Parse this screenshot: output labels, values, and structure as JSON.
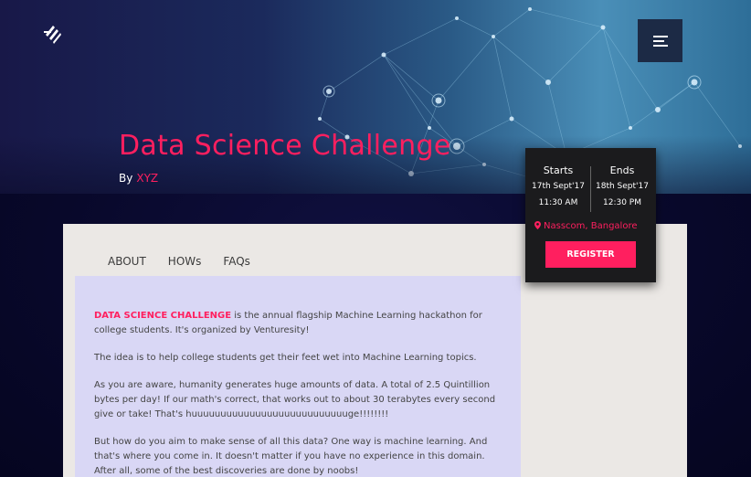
{
  "header": {
    "menu_icon": "hamburger-menu-icon",
    "logo_icon": "brand-logo-icon",
    "title": "Data Science Challenge",
    "by_label": "By",
    "organizer": "XYZ"
  },
  "event": {
    "starts_label": "Starts",
    "ends_label": "Ends",
    "start_date": "17th Sept'17",
    "end_date": "18th Sept'17",
    "start_time": "11:30 AM",
    "end_time": "12:30 PM",
    "venue_icon": "map-pin-icon",
    "venue": "Nasscom, Bangalore",
    "register_label": "REGISTER"
  },
  "tabs": [
    {
      "label": "ABOUT"
    },
    {
      "label": "HOWs"
    },
    {
      "label": "FAQs"
    }
  ],
  "about": {
    "p1_highlight": "DATA SCIENCE CHALLENGE",
    "p1_rest": " is the annual flagship Machine Learning hackathon for college students. It's organized by Venturesity!",
    "p2": "The idea is to help college students get their feet wet into Machine Learning topics.",
    "p3": "As you are aware, humanity generates huge amounts of data. A total of 2.5 Quintillion bytes per day! If our math's correct, that works out to about 30 terabytes every second give or take! That's huuuuuuuuuuuuuuuuuuuuuuuuuuuge!!!!!!!!",
    "p4": "But how do you aim to make sense of all this data? One way is machine learning. And that's where you come in. It doesn't matter if you have no experience in this domain. After all, some of the best discoveries are done by noobs!"
  },
  "colors": {
    "accent": "#ff1f5f",
    "hero_dark": "#181848",
    "content_bg": "#d9d7f5",
    "card_bg": "#ebe8e5",
    "event_card_bg": "#1b1b1d"
  }
}
